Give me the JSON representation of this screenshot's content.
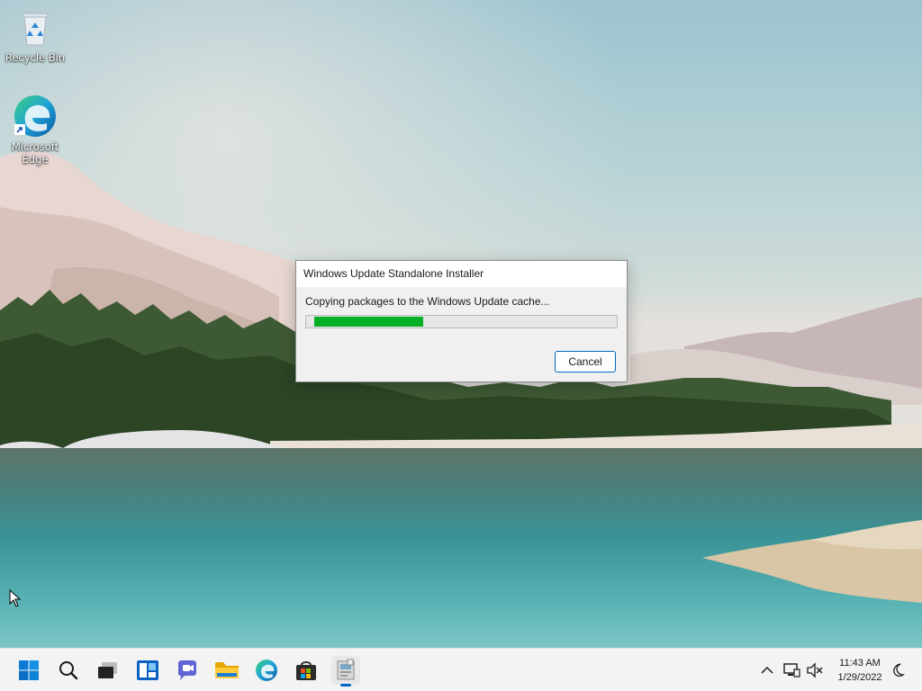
{
  "desktop": {
    "icons": [
      {
        "label": "Recycle Bin",
        "icon": "recycle-bin-icon"
      },
      {
        "label": "Microsoft Edge",
        "label_line1": "Microsoft",
        "label_line2": "Edge",
        "icon": "edge-icon"
      }
    ]
  },
  "dialog": {
    "title": "Windows Update Standalone Installer",
    "message": "Copying packages to the Windows Update cache...",
    "progress": 0.37,
    "cancel_label": "Cancel"
  },
  "taskbar": {
    "apps": [
      {
        "name": "start",
        "icon": "windows-start-icon"
      },
      {
        "name": "search",
        "icon": "search-icon"
      },
      {
        "name": "task-view",
        "icon": "task-view-icon"
      },
      {
        "name": "widgets",
        "icon": "widgets-icon"
      },
      {
        "name": "chat",
        "icon": "teams-chat-icon"
      },
      {
        "name": "file-explorer",
        "icon": "folder-icon"
      },
      {
        "name": "edge",
        "icon": "edge-icon"
      },
      {
        "name": "store",
        "icon": "store-icon"
      },
      {
        "name": "installer",
        "icon": "installer-icon",
        "active": true
      }
    ],
    "tray": {
      "icons": [
        "chevron-up-icon",
        "network-icon",
        "volume-muted-icon",
        "night-light-icon"
      ],
      "time": "11:43 AM",
      "date": "1/29/2022"
    }
  },
  "colors": {
    "accent": "#0067c0",
    "progress_fill": "#06b025",
    "dialog_bg": "#f0f0f0",
    "taskbar_bg": "#f3f3f3"
  }
}
